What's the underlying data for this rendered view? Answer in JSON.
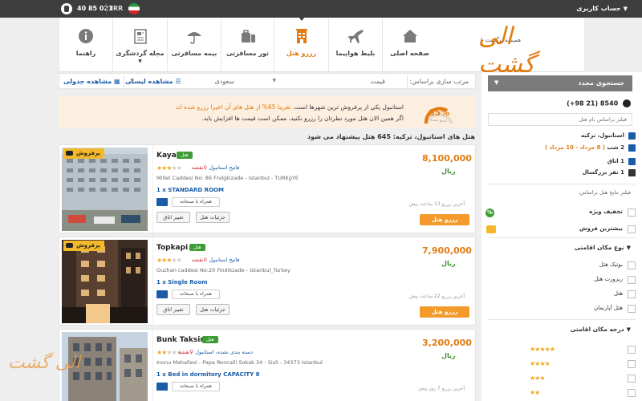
{
  "topbar": {
    "account": "حساب کاربری",
    "phone": "021 85 40",
    "currency": "IRR"
  },
  "logo": {
    "name": "الی گشت",
    "tagline": "همیشه پرگشت با"
  },
  "nav": [
    {
      "label": "صفحه اصلی",
      "icon": "home-icon"
    },
    {
      "label": "بلیط هواپیما",
      "icon": "airplane-icon"
    },
    {
      "label": "رزرو هتل",
      "icon": "hotel-icon",
      "active": true
    },
    {
      "label": "تور مسافرتی",
      "icon": "luggage-icon"
    },
    {
      "label": "بیمه مسافرتی",
      "icon": "umbrella-icon"
    },
    {
      "label": "مجله گردشگری",
      "icon": "magazine-icon"
    },
    {
      "label": "راهنما",
      "icon": "info-icon"
    }
  ],
  "sortbar": {
    "label": "مرتب سازی براساس:",
    "price": "قیمت",
    "stars": "سعودی",
    "list_view": "مشاهده لیستی",
    "grid_view": "مشاهده جدولی"
  },
  "banner": {
    "line1_a": "استانبول یکی از پرفروش ترین شهرها است.",
    "line1_b": "تقریبا 65% از هتل های آن اخیرا رزرو شده اند",
    "line2": "اگر همین الان هتل مورد نظرتان را رزرو نکنید، ممکن است قیمت ها افزایش یابد.",
    "percent": "65%",
    "percent_label": "رزرو شده"
  },
  "results_title": "هتل های استانبول، ترکیه: 645 هتل پیشنهاد می شود",
  "hotels": [
    {
      "badge": "پرفروش",
      "name": "Kaya",
      "type": "هتل",
      "stars": 3,
      "area": "فاتیح استانبول",
      "map": "نقشه",
      "address": "Millet Caddesi No: 86 Fndgkizade - Istanbul - TURKgYE",
      "room": "1 x STANDARD ROOM",
      "breakfast": "همراه با صبحانه",
      "details": "جزئیات هتل",
      "change_room": "تغییر اتاق",
      "price": "8,100,000",
      "currency": "ریال",
      "recent": "آخرین رزرو 13 ساعت پیش",
      "book": "رزرو هتل"
    },
    {
      "badge": "پرفروش",
      "name": "Topkapi",
      "type": "هتل",
      "stars": 3,
      "area": "فاتیح استانبول",
      "map": "نقشه",
      "address": "Ouzhan caddesi No:20 Findikzade - Istanbul_Turkey",
      "room": "1 x Single Room",
      "breakfast": "همراه با صبحانه",
      "details": "جزئیات هتل",
      "change_room": "تغییر اتاق",
      "price": "7,900,000",
      "currency": "ریال",
      "recent": "آخرین رزرو 22 ساعت پیش",
      "book": "رزرو هتل"
    },
    {
      "badge": "",
      "name": "Bunk Taksim",
      "type": "هتل",
      "stars": 2,
      "area": "دسته بندی نشده، استانبول",
      "map": "نقشه",
      "address": "Inonu Mahallesi - Papa Roncalli Sokak 34 - Sisli - 34373 Istanbul",
      "room": "1 x Bed in dormitory CAPACITY 8",
      "breakfast": "همراه با صبحانه",
      "details": "",
      "change_room": "",
      "price": "3,200,000",
      "currency": "ریال",
      "recent": "آخرین رزرو 7 روز پیش",
      "book": ""
    }
  ],
  "sidebar": {
    "search_again": "جستجوی مجدد",
    "phone": "(+98 21) 8540",
    "filter_placeholder": "فیلتر براساس نام هتل",
    "destination": "استانبول، ترکیه",
    "nights": "2 شب",
    "dates": "( 8 مرداد - 10 مرداد )",
    "rooms": "1 اتاق",
    "adults": "1 نفر بزرگسال",
    "filter_title": "فیلتر نتایج هتل براساس:",
    "special_offer": "تخفیف ویژه",
    "best_seller": "بیشترین فروش",
    "accommodation_type": "نوع مکان اقامتی",
    "types": [
      "بوتیک هتل",
      "ریزورت هتل",
      "هتل",
      "هتل آپارتمان"
    ],
    "star_rating": "درجه مکان اقامتی",
    "star_rows": [
      5,
      4,
      3,
      2
    ]
  },
  "watermark": "الی گشت"
}
